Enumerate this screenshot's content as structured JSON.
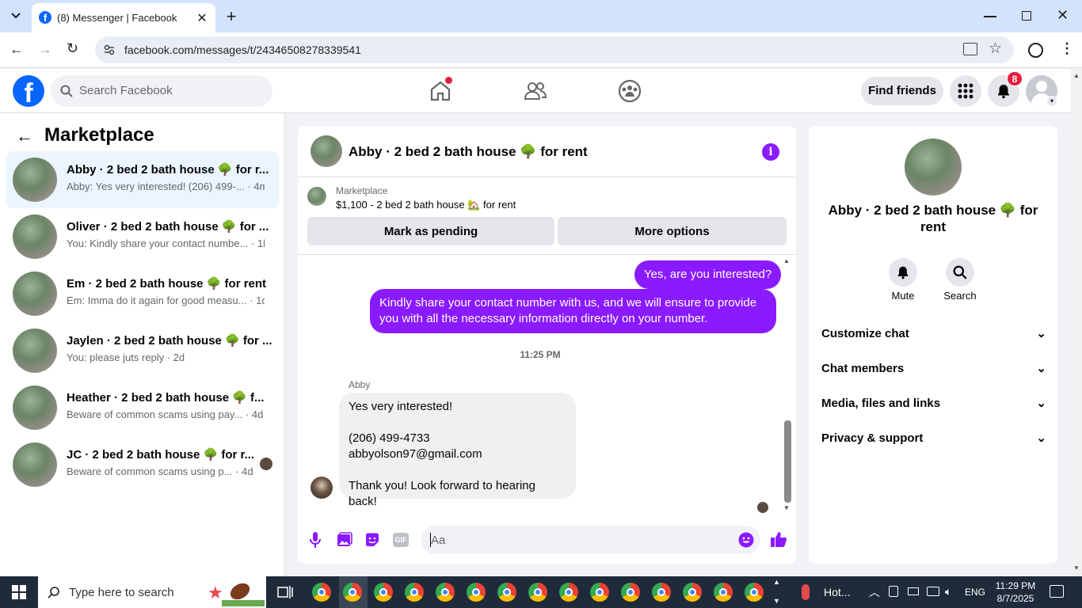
{
  "browser": {
    "tab_title": "(8) Messenger | Facebook",
    "url": "facebook.com/messages/t/24346508278339541"
  },
  "header": {
    "search_placeholder": "Search Facebook",
    "find_friends": "Find friends",
    "notif_count": "8"
  },
  "left": {
    "title": "Marketplace",
    "conversations": [
      {
        "title": "Abby · 2 bed 2 bath house 🌳 for r...",
        "preview": "Abby: Yes very interested! (206) 499-...",
        "time": "· 4m"
      },
      {
        "title": "Oliver · 2 bed 2 bath house 🌳 for ...",
        "preview": "You: Kindly share your contact numbe...",
        "time": "· 1h"
      },
      {
        "title": "Em · 2 bed 2 bath house 🌳 for rent",
        "preview": "Em: Imma do it again for good measu...",
        "time": "· 1d"
      },
      {
        "title": "Jaylen · 2 bed 2 bath house 🌳 for ...",
        "preview": "You: please juts reply",
        "time": "· 2d"
      },
      {
        "title": "Heather · 2 bed 2 bath house 🌳 f...",
        "preview": "Beware of common scams using pay...",
        "time": "· 4d"
      },
      {
        "title": "JC · 2 bed 2 bath house 🌳 for r...",
        "preview": "Beware of common scams using p...",
        "time": "· 4d"
      }
    ]
  },
  "chat": {
    "title": "Abby · 2 bed 2 bath house 🌳 for rent",
    "listing_source": "Marketplace",
    "listing_desc": "$1,100 - 2 bed 2 bath house 🏡 for rent",
    "mark_pending": "Mark as pending",
    "more_options": "More options",
    "msg_out_1": "Yes, are you interested?",
    "msg_out_2": "Kindly share your contact number with us, and we will ensure to provide you with all the necessary information directly on your number.",
    "timestamp": "11:25 PM",
    "sender": "Abby",
    "msg_in": "Yes very interested!\n\n(206) 499-4733\nabbyolson97@gmail.com\n\nThank you! Look forward to hearing back!",
    "input_placeholder": "Aa"
  },
  "right": {
    "title": "Abby · 2 bed 2 bath house 🌳 for rent",
    "mute": "Mute",
    "search": "Search",
    "sections": [
      "Customize chat",
      "Chat members",
      "Media, files and links",
      "Privacy & support"
    ]
  },
  "taskbar": {
    "search_placeholder": "Type here to search",
    "weather": "Hot...",
    "lang": "ENG",
    "time": "11:29 PM",
    "date": "8/7/2025"
  }
}
